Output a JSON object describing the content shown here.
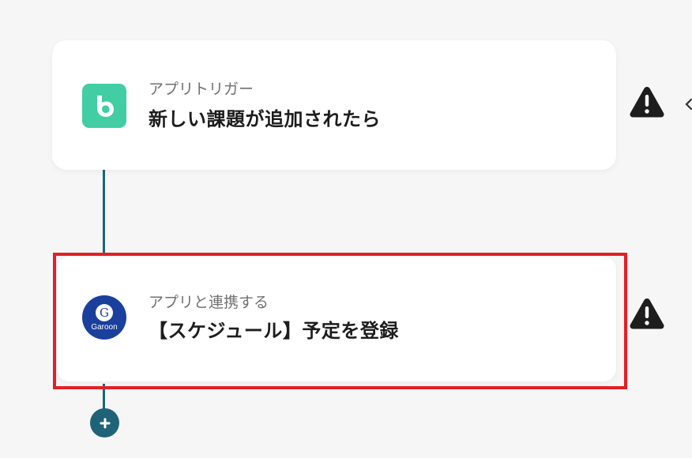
{
  "flow": {
    "trigger": {
      "subtitle": "アプリトリガー",
      "title": "新しい課題が追加されたら",
      "app_icon": "backlog-icon",
      "app_color": "#42cda4"
    },
    "action": {
      "subtitle": "アプリと連携する",
      "title": "【スケジュール】予定を登録",
      "app_icon": "garoon-icon",
      "app_color": "#1a3f9c",
      "icon_letter": "G",
      "icon_text": "Garoon"
    }
  },
  "colors": {
    "connector": "#1f6378",
    "highlight": "#e21f26",
    "warning": "#1d1d1d"
  },
  "icons": {
    "warning": "warning-icon",
    "add": "plus-icon"
  }
}
